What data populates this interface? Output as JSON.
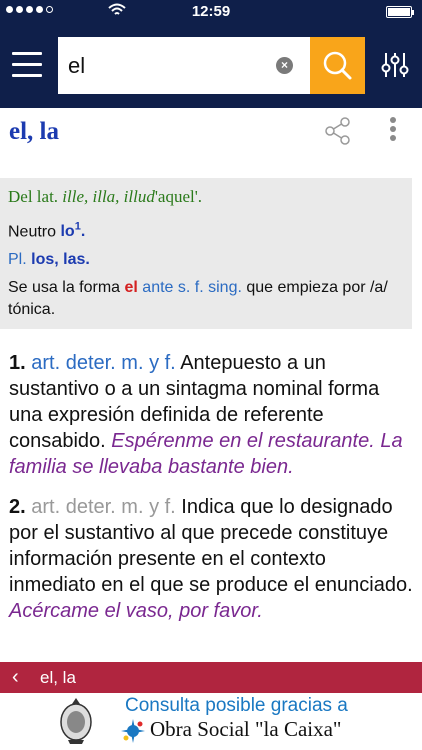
{
  "status": {
    "time": "12:59"
  },
  "search": {
    "value": "el",
    "clear_label": "×"
  },
  "entry": {
    "title": "el, la"
  },
  "info": {
    "ety_prefix": "Del lat. ",
    "ety_words": "ille, illa, illud",
    "ety_gloss": "'aquel'.",
    "neutro_label": "Neutro ",
    "neutro_word": "lo",
    "neutro_sup": "1",
    "neutro_end": ".",
    "pl_abbr": "Pl.",
    "pl_words": "los, las.",
    "use_1": "Se usa la forma ",
    "use_el": "el",
    "use_abbr": "ante s. f. sing.",
    "use_2": " que empieza por /a/ tónica."
  },
  "definitions": [
    {
      "num": "1.",
      "abbr": "art. deter. m. y f.",
      "text": " Antepuesto a un sustantivo o a un sintagma nominal forma una expresión definida de referente consabido. ",
      "example": "Espérenme en el restaurante. La familia se llevaba bastante bien."
    },
    {
      "num": "2.",
      "abbr": "art. deter. m. y f.",
      "text": " Indica que lo designado por el sustantivo al que precede constituye información presente en el contexto inmediato en el que se produce el enunciado. ",
      "example": "Acércame el vaso, por favor."
    }
  ],
  "breadcrumb": {
    "chevron": "‹",
    "label": "el, la"
  },
  "footer": {
    "line1": "Consulta posible gracias a",
    "line2": "Obra Social \"la Caixa\""
  },
  "colors": {
    "navy": "#0f1f4a",
    "search_orange": "#f9a51a",
    "breadcrumb_red": "#b0253f",
    "link_blue": "#2b6bc2"
  },
  "icons": [
    "menu-icon",
    "clear-icon",
    "search-icon",
    "settings-sliders-icon",
    "share-icon",
    "more-vertical-icon",
    "chevron-left-icon",
    "rae-seal-icon",
    "caixa-star-icon"
  ]
}
